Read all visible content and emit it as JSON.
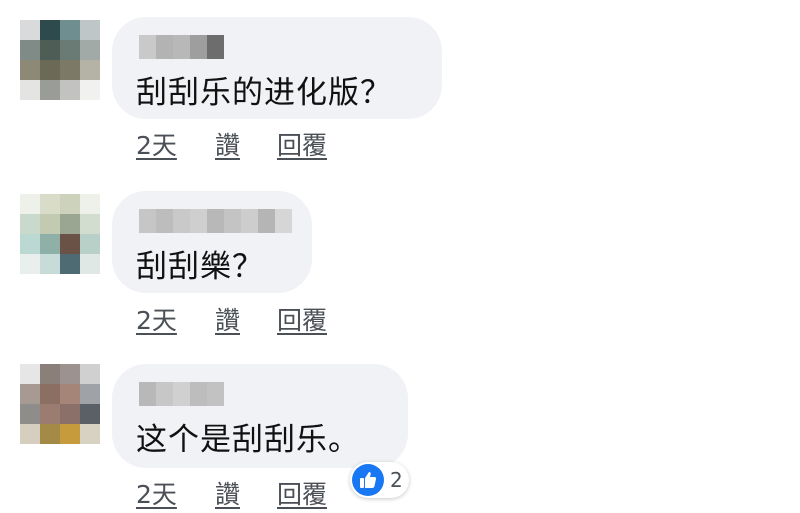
{
  "comments": [
    {
      "text": "刮刮乐的进化版？",
      "actions": {
        "time": "2天",
        "like": "讚",
        "reply": "回覆"
      },
      "avatar_colors": [
        "#d8dadb",
        "#2f4a4d",
        "#6f8e90",
        "#bfc6c7",
        "#7f8b87",
        "#4f5d57",
        "#6a7a74",
        "#a2aaa7",
        "#8c8a77",
        "#6b6a56",
        "#7c7a66",
        "#b5b3a6",
        "#e4e5e3",
        "#9a9c97",
        "#c2c3c0",
        "#f1f1f0"
      ],
      "name_blur_colors": [
        "#c9c9c9",
        "#b3b3b3",
        "#b8b8b8",
        "#9e9e9e",
        "#6d6d6d"
      ]
    },
    {
      "text": "刮刮樂？",
      "actions": {
        "time": "2天",
        "like": "讚",
        "reply": "回覆"
      },
      "avatar_colors": [
        "#eef0ea",
        "#d9dcc8",
        "#cdd2bd",
        "#eef0ea",
        "#c9d9cc",
        "#c2cab2",
        "#9aa592",
        "#d2ddd0",
        "#bcd8d2",
        "#8fb0a6",
        "#6a5246",
        "#b9d0c8",
        "#e8efec",
        "#c7dcd8",
        "#4e6b74",
        "#dfe8e4"
      ],
      "name_blur_colors": [
        "#c6c6c6",
        "#bdbdbd",
        "#c9c9c9",
        "#cfcfcf",
        "#b8b8b8",
        "#c4c4c4",
        "#cdcdcd",
        "#b5b5b5",
        "#d6d6d6"
      ]
    },
    {
      "text": "这个是刮刮乐。",
      "actions": {
        "time": "2天",
        "like": "讚",
        "reply": "回覆"
      },
      "avatar_colors": [
        "#e6e6e6",
        "#8a7f79",
        "#9c9290",
        "#d0d0d0",
        "#a69a93",
        "#8c6f63",
        "#a58578",
        "#9fa3a7",
        "#8e8d8a",
        "#9a7c70",
        "#8b7069",
        "#5b5f66",
        "#d6cfbf",
        "#a48a47",
        "#c59b3c",
        "#d8d2c2"
      ],
      "name_blur_colors": [
        "#b8b8b8",
        "#c7c7c7",
        "#d0d0d0",
        "#bdbdbd",
        "#c2c2c2"
      ]
    }
  ],
  "reaction": {
    "icon": "thumbs-up-icon",
    "count": "2",
    "color": "#1877f2"
  }
}
